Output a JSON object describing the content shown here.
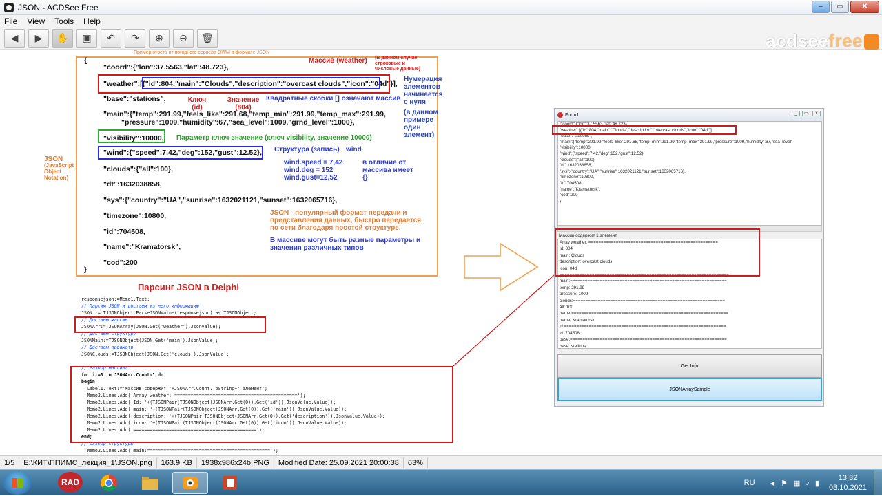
{
  "window": {
    "title": "JSON - ACDSee Free",
    "minimize_label": "–",
    "maximize_label": "▭",
    "close_label": "✕"
  },
  "menu": [
    "File",
    "View",
    "Tools",
    "Help"
  ],
  "logo": {
    "text_a": "acdsee",
    "text_b": "free"
  },
  "slide": {
    "caption": "Пример ответа от погодного сервера OWM в формате JSON",
    "json_lines": [
      "{",
      "\"coord\":{\"lon\":37.5563,\"lat\":48.723},",
      "\"weather\":[{\"id\":804,\"main\":\"Clouds\",\"description\":\"overcast clouds\",\"icon\":\"04d\"}],",
      "\"base\":\"stations\",",
      "\"main\":{\"temp\":291.99,\"feels_like\":291.68,\"temp_min\":291.99,\"temp_max\":291.99,",
      "\"pressure\":1009,\"humidity\":67,\"sea_level\":1009,\"grnd_level\":1000},",
      "\"visibility\":10000,",
      "\"wind\":{\"speed\":7.42,\"deg\":152,\"gust\":12.52},",
      "\"clouds\":{\"all\":100},",
      "\"dt\":1632038858,",
      "\"sys\":{\"country\":\"UA\",\"sunrise\":1632021121,\"sunset\":1632065716},",
      "\"timezone\":10800,",
      "\"id\":704508,",
      "\"name\":\"Kramatorsk\",",
      "\"cod\":200",
      "}"
    ],
    "notes": {
      "massiv": "Массив (weather)",
      "massiv_sub": "(В данном случае строковые и числовые данные)",
      "numeracia": "Нумерация элементов начинается с нуля",
      "numeracia_sub": "(в данном примере один элемент)",
      "kluch": "Ключ (id)",
      "znachenie": "Значение (804)",
      "kvadrat": "Квадратные скобки [] означают массив",
      "param": "Параметр ключ-значение (ключ visibility, значение 10000)",
      "struct": "Структура (запись)",
      "struct_name": "wind",
      "wind_fields": "wind.speed = 7,42\nwind.deg = 152\nwind.gust=12,52",
      "otlichie": "в отличие от массива имеет {}",
      "popular": "JSON - популярный формат передачи и представления данных, быстро передается по сети благодаря простой структуре.",
      "raznye": "В массиве могут быть разные параметры и значения различных типов",
      "side_json": "JSON",
      "side_json_sub": "(JavaScript Object Notation)"
    },
    "delphi_title": "Парсинг JSON в Delphi",
    "code_lines": [
      {
        "t": "responsejson:=Memo1.Text;",
        "k": "n"
      },
      {
        "t": "// Парсим JSON и достаем из него информацию",
        "k": "c"
      },
      {
        "t": "JSON := TJSONObject.ParseJSONValue(responsejson) as TJSONObject;",
        "k": "n"
      },
      {
        "t": "// Достаем массив",
        "k": "c"
      },
      {
        "t": "JSONArr:=TJSONArray(JSON.Get('weather').JsonValue);",
        "k": "n"
      },
      {
        "t": "// Достаем структуру",
        "k": "c"
      },
      {
        "t": "JSONMain:=TJSONObject(JSON.Get('main').JsonValue);",
        "k": "n"
      },
      {
        "t": "// Достаем параметр",
        "k": "c"
      },
      {
        "t": "JSONClouds:=TJSONObject(JSON.Get('clouds').JsonValue);",
        "k": "n"
      },
      {
        "t": "",
        "k": "n"
      },
      {
        "t": "// Разбор массива",
        "k": "c"
      },
      {
        "t": "for i:=0 to JSONArr.Count-1 do",
        "k": "k"
      },
      {
        "t": "begin",
        "k": "k"
      },
      {
        "t": "  Label1.Text:='Массив содержит '+JSONArr.Count.ToString+' элемент';",
        "k": "n"
      },
      {
        "t": "  Memo2.Lines.Add('Array weather: =============================================');",
        "k": "n"
      },
      {
        "t": "  Memo2.Lines.Add('Id: '+(TJSONPair(TJSONObject(JSONArr.Get(0)).Get('id')).JsonValue.Value));",
        "k": "n"
      },
      {
        "t": "  Memo2.Lines.Add('main: '+(TJSONPair(TJSONObject(JSONArr.Get(0)).Get('main')).JsonValue.Value));",
        "k": "n"
      },
      {
        "t": "  Memo2.Lines.Add('description: '+(TJSONPair(TJSONObject(JSONArr.Get(0)).Get('description')).JsonValue.Value));",
        "k": "n"
      },
      {
        "t": "  Memo2.Lines.Add('icon: '+(TJSONPair(TJSONObject(JSONArr.Get(0)).Get('icon')).JsonValue.Value));",
        "k": "n"
      },
      {
        "t": "  Memo2.Lines.Add('=============================================');",
        "k": "n"
      },
      {
        "t": "end;",
        "k": "k"
      },
      {
        "t": "// разбор структуры",
        "k": "c"
      },
      {
        "t": "  Memo2.Lines.Add('main:=============================================');",
        "k": "n"
      }
    ]
  },
  "form": {
    "title": "Form1",
    "memo1": [
      "{\"coord\":{\"lon\":37.5563,\"lat\":48.723},",
      "\"weather\":[{\"id\":804,\"main\":\"Clouds\",\"description\":\"overcast clouds\",\"icon\":\"04d\"}],",
      "\"base\":\"stations\",",
      "\"main\":{\"temp\":291.99,\"feels_like\":291.68,\"temp_min\":291.99,\"temp_max\":291.99,\"pressure\":1009,\"humidity\":67,\"sea_level\"",
      "\"visibility\":10000,",
      "\"wind\":{\"speed\":7.42,\"deg\":152,\"gust\":12.52},",
      "\"clouds\":{\"all\":100},",
      "\"dt\":1632038858,",
      "\"sys\":{\"country\":\"UA\",\"sunrise\":1632021121,\"sunset\":1632065716},",
      "\"timezone\":10800,",
      "\"id\":704508,",
      "\"name\":\"Kramatorsk\",",
      "\"cod\":200",
      "}"
    ],
    "label1": "Массив содержит 1 элемент",
    "memo2": [
      "Array weather: ====================================================",
      "Id: 804",
      "main: Clouds",
      "description: overcast clouds",
      "icon: 04d",
      "====================================================================",
      "main:===============================================================",
      "temp: 291.99",
      "pressure: 1009",
      "clouds:=============================================================",
      "all: 100",
      "name:===============================================================",
      "name: Kramatorsk",
      "id:=================================================================",
      "id: 704508",
      "base:===============================================================",
      "base: stations"
    ],
    "btn_get_info": "Get Info",
    "btn_sample": "JSONArraySample"
  },
  "status": {
    "index": "1/5",
    "path": "E:\\КИТ\\ППИМС_лекция_1\\JSON.png",
    "size": "163.9 KB",
    "dims": "1938x986x24b PNG",
    "modified": "Modified Date: 25.09.2021 20:00:38",
    "zoom": "63%"
  },
  "taskbar": {
    "lang": "RU",
    "time": "13:32",
    "date": "03.10.2021",
    "rad": "RAD"
  }
}
